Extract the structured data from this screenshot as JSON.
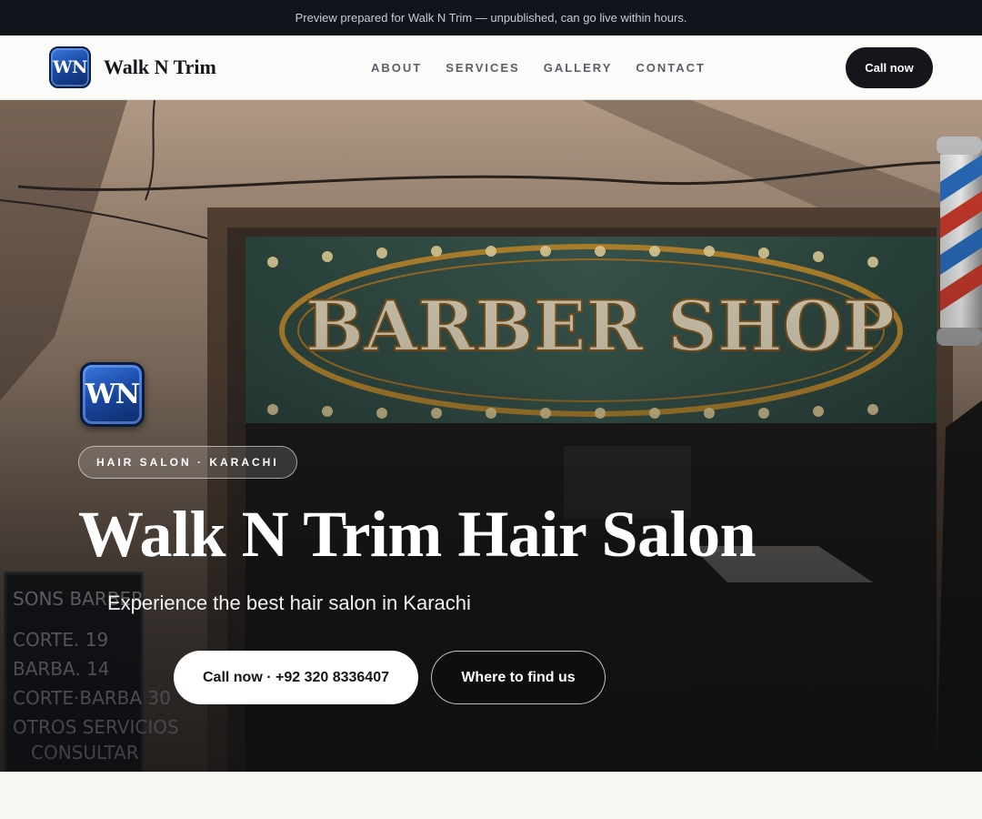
{
  "preview_bar": {
    "text": "Preview prepared for Walk N Trim — unpublished, can go live within hours."
  },
  "header": {
    "logo_text": "WN",
    "brand_name": "Walk N Trim",
    "nav": [
      {
        "label": "ABOUT"
      },
      {
        "label": "SERVICES"
      },
      {
        "label": "GALLERY"
      },
      {
        "label": "CONTACT"
      }
    ],
    "cta_label": "Call now"
  },
  "hero": {
    "background_image": "barbershop-storefront-photo",
    "logo_text": "WN",
    "badge": "HAIR SALON · KARACHI",
    "title": "Walk N Trim Hair Salon",
    "subtitle": "Experience the best hair salon in Karachi",
    "primary_button": "Call now · +92 320 8336407",
    "secondary_button": "Where to find us",
    "photo_sign_text": "BARBER SHOP",
    "chalkboard": {
      "title": "SONS of BARBER",
      "lines": [
        "CORTE.      19",
        "BARBA.      14",
        "CORTE y BARBA 30",
        "OTROS SERVICIOS",
        "CONSULTAR"
      ]
    }
  },
  "colors": {
    "dark": "#14161b",
    "brand_blue": "#1b4aa6",
    "page_bg": "#f8f7f4"
  }
}
